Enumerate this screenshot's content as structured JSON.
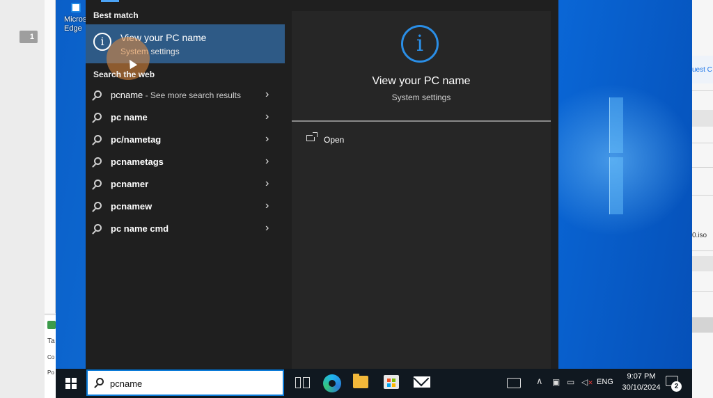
{
  "host": {
    "badge": "1",
    "right_fragments": [
      "uest C",
      "0.iso"
    ],
    "bottom_rows": [
      "Ta",
      "Co",
      "Po"
    ]
  },
  "desktop": {
    "icon_label": "Microsoft Edge",
    "icon_label_display": "Micros Edge"
  },
  "best_match": {
    "section_title": "Best match",
    "title": "View your PC name",
    "subtitle": "System settings"
  },
  "web": {
    "section_title": "Search the web",
    "items": [
      {
        "label": "pcname",
        "hint": " - See more search results",
        "bold": false
      },
      {
        "label": "pc name",
        "hint": "",
        "bold": true
      },
      {
        "label": "pc/nametag",
        "hint": "",
        "bold": true
      },
      {
        "label": "pcnametags",
        "hint": "",
        "bold": true
      },
      {
        "label": "pcnamer",
        "hint": "",
        "bold": true
      },
      {
        "label": "pcnamew",
        "hint": "",
        "bold": true
      },
      {
        "label": "pc name cmd",
        "hint": "",
        "bold": true
      }
    ]
  },
  "detail": {
    "title": "View your PC name",
    "subtitle": "System settings",
    "open_label": "Open"
  },
  "taskbar": {
    "search_value": "pcname",
    "language": "ENG",
    "time": "9:07 PM",
    "date": "30/10/2024",
    "notification_count": "2"
  },
  "colors": {
    "accent": "#2a8ee6",
    "selection": "#2e5a86",
    "panel": "#1f1f1f",
    "taskbar": "#101820"
  },
  "icons": [
    "windows-logo-icon",
    "search-icon",
    "info-icon",
    "chevron-right-icon",
    "open-icon",
    "task-view-icon",
    "edge-icon",
    "file-explorer-icon",
    "store-icon",
    "mail-icon",
    "news-icon",
    "chevron-up-icon",
    "network-icon",
    "volume-muted-icon",
    "notification-icon"
  ]
}
